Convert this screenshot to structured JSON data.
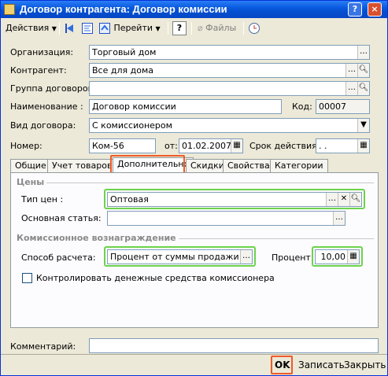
{
  "window": {
    "title": "Договор контрагента: Договор комиссии",
    "help_button": "?",
    "close_button": "×"
  },
  "toolbar": {
    "actions_label": "Действия",
    "goto_label": "Перейти",
    "help_label": "?",
    "files_label": "Файлы"
  },
  "form": {
    "organization_label": "Организация:",
    "organization_value": "Торговый дом",
    "counterparty_label": "Контрагент:",
    "counterparty_value": "Все для дома",
    "group_label": "Группа договоров:",
    "group_value": "",
    "name_label": "Наименование :",
    "name_value": "Договор комиссии",
    "code_label": "Код:",
    "code_value": "00007",
    "type_label": "Вид договора:",
    "type_value": "С комиссионером",
    "number_label": "Номер:",
    "number_value": "Ком-56",
    "from_label": "от:",
    "from_value": "01.02.2007",
    "validity_label": "Срок действия:",
    "validity_value": " .  ."
  },
  "tabs": [
    "Общие",
    "Учет товаров",
    "Дополнительно",
    "Скидки",
    "Свойства",
    "Категории"
  ],
  "active_tab": "Дополнительно",
  "panel": {
    "prices_section": "Цены",
    "price_type_label": "Тип цен :",
    "price_type_value": "Оптовая",
    "main_article_label": "Основная статья:",
    "main_article_value": "",
    "commission_section": "Комиссионное вознаграждение",
    "calc_method_label": "Способ расчета:",
    "calc_method_value": "Процент от суммы продажи",
    "percent_label": "Процент:",
    "percent_value": "10,00",
    "control_checkbox_label": "Контролировать денежные средства комиссионера",
    "control_checkbox_checked": false
  },
  "comment": {
    "label": "Комментарий:",
    "value": ""
  },
  "footer": {
    "ok_label": "OK",
    "save_label": "Записать",
    "close_label": "Закрыть"
  },
  "colors": {
    "highlight_green": "#6cd34a",
    "highlight_red": "#f05a28",
    "title_bar": "#0a5adf"
  }
}
